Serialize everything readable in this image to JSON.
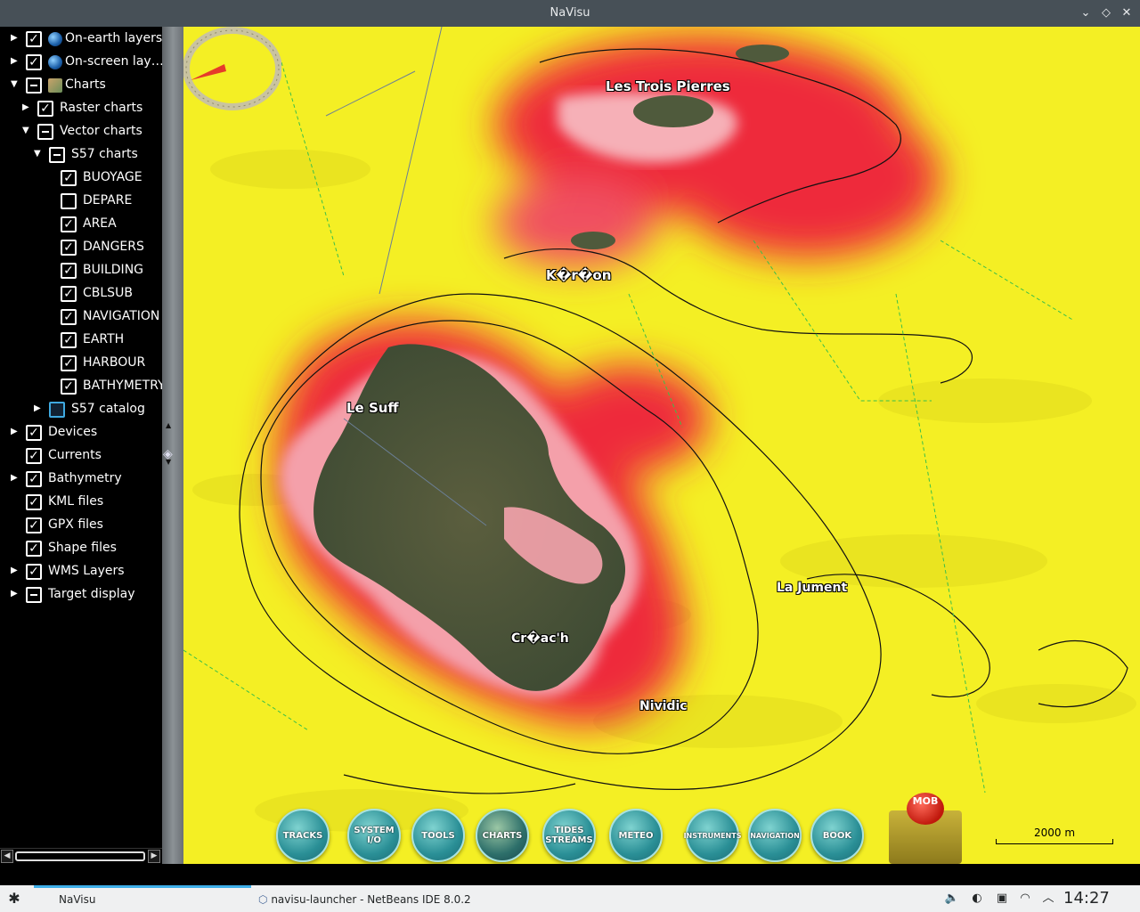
{
  "window": {
    "title": "NaVisu",
    "controls": [
      "chevron-down-icon",
      "diamond-icon",
      "close-icon"
    ]
  },
  "tree": [
    {
      "label": "On-earth layers",
      "depth": 0,
      "expander": "collapsed",
      "check": "checked",
      "icon": "globe-icon"
    },
    {
      "label": "On-screen lay…",
      "depth": 0,
      "expander": "collapsed",
      "check": "checked",
      "icon": "screen-globe-icon"
    },
    {
      "label": "Charts",
      "depth": 0,
      "expander": "expanded",
      "check": "partial",
      "icon": "chart-icon"
    },
    {
      "label": "Raster charts",
      "depth": 1,
      "expander": "collapsed",
      "check": "checked"
    },
    {
      "label": "Vector charts",
      "depth": 1,
      "expander": "expanded",
      "check": "partial"
    },
    {
      "label": "S57 charts",
      "depth": 2,
      "expander": "expanded",
      "check": "partial"
    },
    {
      "label": "BUOYAGE",
      "depth": 3,
      "expander": "none",
      "check": "checked"
    },
    {
      "label": "DEPARE",
      "depth": 3,
      "expander": "none",
      "check": "unchecked"
    },
    {
      "label": "AREA",
      "depth": 3,
      "expander": "none",
      "check": "checked"
    },
    {
      "label": "DANGERS",
      "depth": 3,
      "expander": "none",
      "check": "checked"
    },
    {
      "label": "BUILDING",
      "depth": 3,
      "expander": "none",
      "check": "checked"
    },
    {
      "label": "CBLSUB",
      "depth": 3,
      "expander": "none",
      "check": "checked"
    },
    {
      "label": "NAVIGATION",
      "depth": 3,
      "expander": "none",
      "check": "checked"
    },
    {
      "label": "EARTH",
      "depth": 3,
      "expander": "none",
      "check": "checked"
    },
    {
      "label": "HARBOUR",
      "depth": 3,
      "expander": "none",
      "check": "checked"
    },
    {
      "label": "BATHYMETRY",
      "depth": 3,
      "expander": "none",
      "check": "checked"
    },
    {
      "label": "S57 catalog",
      "depth": 2,
      "expander": "collapsed",
      "check": "catalog"
    },
    {
      "label": "Devices",
      "depth": 0,
      "expander": "collapsed",
      "check": "checked"
    },
    {
      "label": "Currents",
      "depth": 0,
      "expander": "none",
      "check": "checked"
    },
    {
      "label": "Bathymetry",
      "depth": 0,
      "expander": "collapsed",
      "check": "checked"
    },
    {
      "label": "KML files",
      "depth": 0,
      "expander": "none",
      "check": "checked"
    },
    {
      "label": "GPX files",
      "depth": 0,
      "expander": "none",
      "check": "checked"
    },
    {
      "label": "Shape files",
      "depth": 0,
      "expander": "none",
      "check": "checked"
    },
    {
      "label": "WMS Layers",
      "depth": 0,
      "expander": "collapsed",
      "check": "checked"
    },
    {
      "label": "Target display",
      "depth": 0,
      "expander": "collapsed",
      "check": "partial"
    }
  ],
  "map": {
    "places": {
      "les_trois_pierres": "Les Trois Pierres",
      "keron": "K�r�on",
      "le_suff": "Le Suff",
      "la_jument": "La Jument",
      "creach": "Cr�ac'h",
      "nividic": "Nividic"
    },
    "scale_label": "2000 m",
    "colors": {
      "sea_yellow": "#f3ee20",
      "heat_red": "#ee2a3a",
      "shallow_pink": "#f4a0aa",
      "land": "#5b5e3e"
    }
  },
  "toolbar": {
    "tracks": "TRACKS",
    "system_io_1": "SYSTEM",
    "system_io_2": "I/O",
    "tools": "TOOLS",
    "charts": "CHARTS",
    "tides_1": "TIDES",
    "tides_2": "STREAMS",
    "meteo": "METEO",
    "instruments": "INSTRUMENTS",
    "navigation": "NAVIGATION",
    "book": "BOOK",
    "mob": "MOB"
  },
  "taskbar": {
    "tasks": {
      "navisu": "NaVisu",
      "netbeans": "navisu-launcher - NetBeans IDE 8.0.2"
    },
    "clock": "14:27"
  }
}
